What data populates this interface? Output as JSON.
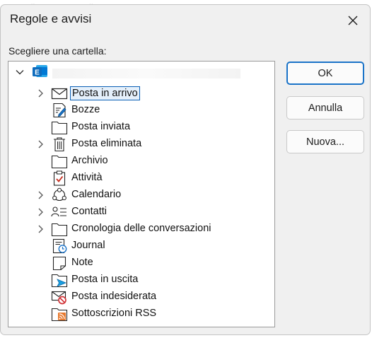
{
  "dialog": {
    "title": "Regole e avvisi",
    "prompt": "Scegliere una cartella:"
  },
  "buttons": {
    "ok": "OK",
    "cancel": "Annulla",
    "new": "Nuova..."
  },
  "tree": {
    "root_icon": "outlook-exchange-icon",
    "folders": [
      {
        "label": "Posta in arrivo",
        "icon": "inbox-envelope-icon",
        "expandable": true,
        "selected": true
      },
      {
        "label": "Bozze",
        "icon": "drafts-pencil-icon",
        "expandable": false
      },
      {
        "label": "Posta inviata",
        "icon": "folder-icon",
        "expandable": false
      },
      {
        "label": "Posta eliminata",
        "icon": "trash-icon",
        "expandable": true
      },
      {
        "label": "Archivio",
        "icon": "folder-icon",
        "expandable": false
      },
      {
        "label": "Attività",
        "icon": "tasks-clipboard-icon",
        "expandable": false
      },
      {
        "label": "Calendario",
        "icon": "calendar-people-icon",
        "expandable": true
      },
      {
        "label": "Contatti",
        "icon": "contacts-icon",
        "expandable": true
      },
      {
        "label": "Cronologia delle conversazioni",
        "icon": "folder-icon",
        "expandable": true
      },
      {
        "label": "Journal",
        "icon": "journal-clock-icon",
        "expandable": false
      },
      {
        "label": "Note",
        "icon": "note-icon",
        "expandable": false
      },
      {
        "label": "Posta in uscita",
        "icon": "outbox-arrow-icon",
        "expandable": false
      },
      {
        "label": "Posta indesiderata",
        "icon": "junk-mail-icon",
        "expandable": false
      },
      {
        "label": "Sottoscrizioni RSS",
        "icon": "rss-folder-icon",
        "expandable": false
      }
    ]
  },
  "colors": {
    "accent": "#1a73c8",
    "selection_border": "#0a5fb5",
    "outlook_blue": "#0f6cbd",
    "rss_orange": "#e8792e",
    "junk_red": "#d13438",
    "task_red": "#c42b1c"
  }
}
